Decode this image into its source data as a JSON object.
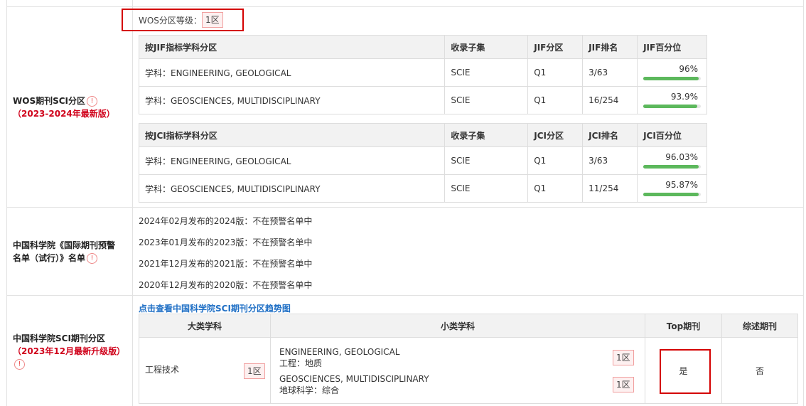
{
  "wos": {
    "label": "WOS期刊SCI分区",
    "sub": "（2023-2024年最新版）",
    "level_label": "WOS分区等级：",
    "level_value": "1区",
    "jif": {
      "headers": [
        "按JIF指标学科分区",
        "收录子集",
        "JIF分区",
        "JIF排名",
        "JIF百分位"
      ],
      "rows": [
        {
          "subject": "学科：ENGINEERING, GEOLOGICAL",
          "set": "SCIE",
          "zone": "Q1",
          "rank": "3/63",
          "pct": "96%",
          "pct_num": 96
        },
        {
          "subject": "学科：GEOSCIENCES, MULTIDISCIPLINARY",
          "set": "SCIE",
          "zone": "Q1",
          "rank": "16/254",
          "pct": "93.9%",
          "pct_num": 93.9
        }
      ]
    },
    "jci": {
      "headers": [
        "按JCI指标学科分区",
        "收录子集",
        "JCI分区",
        "JCI排名",
        "JCI百分位"
      ],
      "rows": [
        {
          "subject": "学科：ENGINEERING, GEOLOGICAL",
          "set": "SCIE",
          "zone": "Q1",
          "rank": "3/63",
          "pct": "96.03%",
          "pct_num": 96.03
        },
        {
          "subject": "学科：GEOSCIENCES, MULTIDISCIPLINARY",
          "set": "SCIE",
          "zone": "Q1",
          "rank": "11/254",
          "pct": "95.87%",
          "pct_num": 95.87
        }
      ]
    }
  },
  "warning": {
    "label_line1": "中国科学院《国际期刊预警",
    "label_line2": "名单（试行）》名单",
    "items": [
      "2024年02月发布的2024版：不在预警名单中",
      "2023年01月发布的2023版：不在预警名单中",
      "2021年12月发布的2021版：不在预警名单中",
      "2020年12月发布的2020版：不在预警名单中"
    ]
  },
  "cas": {
    "label": "中国科学院SCI期刊分区",
    "sub": "（2023年12月最新升级版）",
    "trend_link": "点击查看中国科学院SCI期刊分区趋势图",
    "headers": [
      "大类学科",
      "小类学科",
      "Top期刊",
      "综述期刊"
    ],
    "major": "工程技术",
    "major_zone": "1区",
    "minors": [
      {
        "en": "ENGINEERING, GEOLOGICAL",
        "cn": "工程：地质",
        "zone": "1区"
      },
      {
        "en": "GEOSCIENCES, MULTIDISCIPLINARY",
        "cn": "地球科学：综合",
        "zone": "1区"
      }
    ],
    "top": "是",
    "review": "否"
  },
  "info_icon": "!"
}
